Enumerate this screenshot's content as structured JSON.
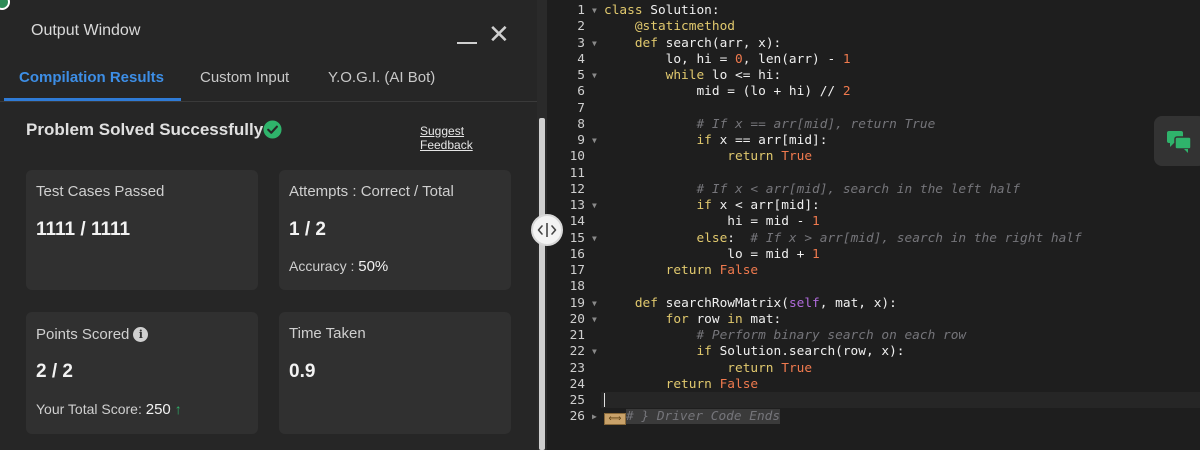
{
  "output_window": {
    "title": "Output Window",
    "minimize_label": "",
    "close_label": "✕",
    "tabs": [
      {
        "label": "Compilation Results",
        "active": true
      },
      {
        "label": "Custom Input",
        "active": false
      },
      {
        "label": "Y.O.G.I. (AI Bot)",
        "active": false
      }
    ],
    "status": "Problem Solved Successfully",
    "suggest_feedback": "Suggest Feedback",
    "cards": {
      "test_cases": {
        "label": "Test Cases Passed",
        "value": "1111 / 1111"
      },
      "attempts": {
        "label": "Attempts : Correct / Total",
        "value": "1 / 2",
        "sub_label": "Accuracy :",
        "sub_value": "50%"
      },
      "points": {
        "label": "Points Scored",
        "value": "2 / 2",
        "sub_label": "Your Total Score:",
        "sub_value": "250"
      },
      "time": {
        "label": "Time Taken",
        "value": "0.9"
      }
    }
  },
  "colors": {
    "accent_blue": "#2f7bd6",
    "success_green": "#2fb36b",
    "keyword_yellow": "#e1c96e",
    "number_orange": "#f07a4e",
    "comment_gray": "#75757a",
    "self_purple": "#b06bdb"
  },
  "icons": [
    "check-circle-icon",
    "info-icon",
    "arrow-up-icon",
    "close-icon",
    "minimize-icon",
    "split-handle-icon",
    "chat-icon"
  ],
  "editor": {
    "lines": [
      {
        "n": "1",
        "fold": true,
        "tokens": [
          [
            "kw",
            "class"
          ],
          [
            "plain",
            " Solution:"
          ]
        ]
      },
      {
        "n": "2",
        "fold": false,
        "tokens": [
          [
            "plain",
            "    "
          ],
          [
            "dec",
            "@staticmethod"
          ]
        ]
      },
      {
        "n": "3",
        "fold": true,
        "tokens": [
          [
            "plain",
            "    "
          ],
          [
            "kw",
            "def"
          ],
          [
            "plain",
            " search(arr, x):"
          ]
        ]
      },
      {
        "n": "4",
        "fold": false,
        "tokens": [
          [
            "plain",
            "        lo, hi = "
          ],
          [
            "num",
            "0"
          ],
          [
            "plain",
            ", len(arr) - "
          ],
          [
            "num",
            "1"
          ]
        ]
      },
      {
        "n": "5",
        "fold": true,
        "tokens": [
          [
            "plain",
            "        "
          ],
          [
            "kw",
            "while"
          ],
          [
            "plain",
            " lo <= hi:"
          ]
        ]
      },
      {
        "n": "6",
        "fold": false,
        "tokens": [
          [
            "plain",
            "            mid = (lo + hi) // "
          ],
          [
            "num",
            "2"
          ]
        ]
      },
      {
        "n": "7",
        "fold": false,
        "tokens": [
          [
            "plain",
            ""
          ]
        ]
      },
      {
        "n": "8",
        "fold": false,
        "tokens": [
          [
            "plain",
            "            "
          ],
          [
            "cm",
            "# If x == arr[mid], return True"
          ]
        ]
      },
      {
        "n": "9",
        "fold": true,
        "tokens": [
          [
            "plain",
            "            "
          ],
          [
            "kw",
            "if"
          ],
          [
            "plain",
            " x == arr[mid]:"
          ]
        ]
      },
      {
        "n": "10",
        "fold": false,
        "tokens": [
          [
            "plain",
            "                "
          ],
          [
            "kw",
            "return"
          ],
          [
            "plain",
            " "
          ],
          [
            "bool",
            "True"
          ]
        ]
      },
      {
        "n": "11",
        "fold": false,
        "tokens": [
          [
            "plain",
            ""
          ]
        ]
      },
      {
        "n": "12",
        "fold": false,
        "tokens": [
          [
            "plain",
            "            "
          ],
          [
            "cm",
            "# If x < arr[mid], search in the left half"
          ]
        ]
      },
      {
        "n": "13",
        "fold": true,
        "tokens": [
          [
            "plain",
            "            "
          ],
          [
            "kw",
            "if"
          ],
          [
            "plain",
            " x < arr[mid]:"
          ]
        ]
      },
      {
        "n": "14",
        "fold": false,
        "tokens": [
          [
            "plain",
            "                hi = mid - "
          ],
          [
            "num",
            "1"
          ]
        ]
      },
      {
        "n": "15",
        "fold": true,
        "tokens": [
          [
            "plain",
            "            "
          ],
          [
            "kw",
            "else"
          ],
          [
            "plain",
            ":  "
          ],
          [
            "cm",
            "# If x > arr[mid], search in the right half"
          ]
        ]
      },
      {
        "n": "16",
        "fold": false,
        "tokens": [
          [
            "plain",
            "                lo = mid + "
          ],
          [
            "num",
            "1"
          ]
        ]
      },
      {
        "n": "17",
        "fold": false,
        "tokens": [
          [
            "plain",
            "        "
          ],
          [
            "kw",
            "return"
          ],
          [
            "plain",
            " "
          ],
          [
            "bool",
            "False"
          ]
        ]
      },
      {
        "n": "18",
        "fold": false,
        "tokens": [
          [
            "plain",
            ""
          ]
        ]
      },
      {
        "n": "19",
        "fold": true,
        "tokens": [
          [
            "plain",
            "    "
          ],
          [
            "kw",
            "def"
          ],
          [
            "plain",
            " searchRowMatrix("
          ],
          [
            "self",
            "self"
          ],
          [
            "plain",
            ", mat, x):"
          ]
        ]
      },
      {
        "n": "20",
        "fold": true,
        "tokens": [
          [
            "plain",
            "        "
          ],
          [
            "kw",
            "for"
          ],
          [
            "plain",
            " row "
          ],
          [
            "kw",
            "in"
          ],
          [
            "plain",
            " mat:"
          ]
        ]
      },
      {
        "n": "21",
        "fold": false,
        "tokens": [
          [
            "plain",
            "            "
          ],
          [
            "cm",
            "# Perform binary search on each row"
          ]
        ]
      },
      {
        "n": "22",
        "fold": true,
        "tokens": [
          [
            "plain",
            "            "
          ],
          [
            "kw",
            "if"
          ],
          [
            "plain",
            " Solution.search(row, x):"
          ]
        ]
      },
      {
        "n": "23",
        "fold": false,
        "tokens": [
          [
            "plain",
            "                "
          ],
          [
            "kw",
            "return"
          ],
          [
            "plain",
            " "
          ],
          [
            "bool",
            "True"
          ]
        ]
      },
      {
        "n": "24",
        "fold": false,
        "tokens": [
          [
            "plain",
            "        "
          ],
          [
            "kw",
            "return"
          ],
          [
            "plain",
            " "
          ],
          [
            "bool",
            "False"
          ]
        ]
      },
      {
        "n": "25",
        "fold": false,
        "tokens": [
          [
            "plain",
            ""
          ]
        ]
      },
      {
        "n": "26",
        "fold": true,
        "tokens": [
          [
            "marker",
            ""
          ],
          [
            "cm",
            "# } Driver Code Ends"
          ]
        ]
      }
    ]
  }
}
